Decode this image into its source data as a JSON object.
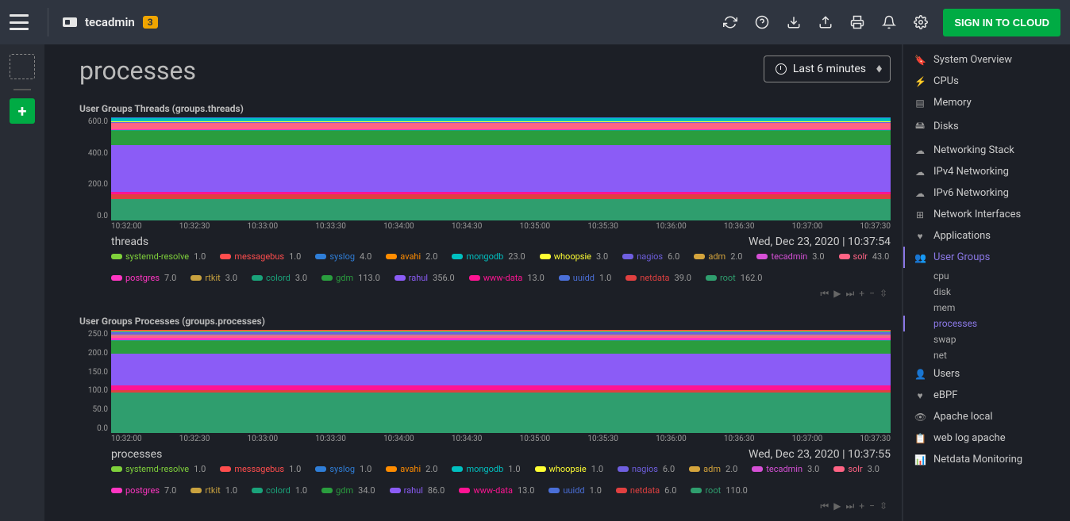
{
  "header": {
    "node_name": "tecadmin",
    "badge": "3",
    "signin": "SIGN IN TO CLOUD"
  },
  "time_picker": "Last 6 minutes",
  "page_title": "processes",
  "nav": [
    {
      "icon": "🔖",
      "label": "System Overview"
    },
    {
      "icon": "⚡",
      "label": "CPUs"
    },
    {
      "icon": "▤",
      "label": "Memory"
    },
    {
      "icon": "🖴",
      "label": "Disks"
    },
    {
      "icon": "☁",
      "label": "Networking Stack"
    },
    {
      "icon": "☁",
      "label": "IPv4 Networking"
    },
    {
      "icon": "☁",
      "label": "IPv6 Networking"
    },
    {
      "icon": "⊞",
      "label": "Network Interfaces"
    },
    {
      "icon": "♥",
      "label": "Applications"
    },
    {
      "icon": "👥",
      "label": "User Groups",
      "active": true,
      "subs": [
        {
          "label": "cpu"
        },
        {
          "label": "disk"
        },
        {
          "label": "mem"
        },
        {
          "label": "processes",
          "active": true
        },
        {
          "label": "swap"
        },
        {
          "label": "net"
        }
      ]
    },
    {
      "icon": "👤",
      "label": "Users"
    },
    {
      "icon": "♥",
      "label": "eBPF"
    },
    {
      "icon": "👁",
      "label": "Apache local"
    },
    {
      "icon": "📋",
      "label": "web log apache"
    },
    {
      "icon": "📊",
      "label": "Netdata Monitoring"
    }
  ],
  "chart_data": [
    {
      "type": "area",
      "title": "User Groups Threads (groups.threads)",
      "unit": "threads",
      "timestamp": "Wed, Dec 23, 2020 | 10:37:54",
      "ylim": [
        0,
        700
      ],
      "yticks": [
        "600.0",
        "400.0",
        "200.0",
        "0.0"
      ],
      "xticks": [
        "10:32:00",
        "10:32:30",
        "10:33:00",
        "10:33:30",
        "10:34:00",
        "10:34:30",
        "10:35:00",
        "10:35:30",
        "10:36:00",
        "10:36:30",
        "10:37:00",
        "10:37:30"
      ],
      "series": [
        {
          "name": "systemd-resolve",
          "value": 1.0,
          "color": "#7fd13b"
        },
        {
          "name": "messagebus",
          "value": 1.0,
          "color": "#ff4d4d"
        },
        {
          "name": "syslog",
          "value": 4.0,
          "color": "#2f7ed8"
        },
        {
          "name": "avahi",
          "value": 2.0,
          "color": "#ff8c00"
        },
        {
          "name": "mongodb",
          "value": 23.0,
          "color": "#00c0c0"
        },
        {
          "name": "whoopsie",
          "value": 3.0,
          "color": "#ffff33"
        },
        {
          "name": "nagios",
          "value": 6.0,
          "color": "#6f5fe0"
        },
        {
          "name": "adm",
          "value": 2.0,
          "color": "#d4a43c"
        },
        {
          "name": "tecadmin",
          "value": 3.0,
          "color": "#d650d6"
        },
        {
          "name": "solr",
          "value": 43.0,
          "color": "#ff6384"
        },
        {
          "name": "postgres",
          "value": 7.0,
          "color": "#ff36c2"
        },
        {
          "name": "rtkit",
          "value": 3.0,
          "color": "#c9a23f"
        },
        {
          "name": "colord",
          "value": 3.0,
          "color": "#1aa37a"
        },
        {
          "name": "gdm",
          "value": 113.0,
          "color": "#2a9d3e"
        },
        {
          "name": "rahul",
          "value": 356.0,
          "color": "#8b5cf6"
        },
        {
          "name": "www-data",
          "value": 13.0,
          "color": "#ff1493"
        },
        {
          "name": "uuidd",
          "value": 1.0,
          "color": "#4a6fd8"
        },
        {
          "name": "netdata",
          "value": 39.0,
          "color": "#e04040"
        },
        {
          "name": "root",
          "value": 162.0,
          "color": "#2f9e6e"
        }
      ]
    },
    {
      "type": "area",
      "title": "User Groups Processes (groups.processes)",
      "unit": "processes",
      "timestamp": "Wed, Dec 23, 2020 | 10:37:55",
      "ylim": [
        0,
        270
      ],
      "yticks": [
        "250.0",
        "200.0",
        "150.0",
        "100.0",
        "50.0",
        "0.0"
      ],
      "xticks": [
        "10:32:00",
        "10:32:30",
        "10:33:00",
        "10:33:30",
        "10:34:00",
        "10:34:30",
        "10:35:00",
        "10:35:30",
        "10:36:00",
        "10:36:30",
        "10:37:00",
        "10:37:30"
      ],
      "series": [
        {
          "name": "systemd-resolve",
          "value": 1.0,
          "color": "#7fd13b"
        },
        {
          "name": "messagebus",
          "value": 1.0,
          "color": "#ff4d4d"
        },
        {
          "name": "syslog",
          "value": 1.0,
          "color": "#2f7ed8"
        },
        {
          "name": "avahi",
          "value": 2.0,
          "color": "#ff8c00"
        },
        {
          "name": "mongodb",
          "value": 1.0,
          "color": "#00c0c0"
        },
        {
          "name": "whoopsie",
          "value": 1.0,
          "color": "#ffff33"
        },
        {
          "name": "nagios",
          "value": 6.0,
          "color": "#6f5fe0"
        },
        {
          "name": "adm",
          "value": 2.0,
          "color": "#d4a43c"
        },
        {
          "name": "tecadmin",
          "value": 3.0,
          "color": "#d650d6"
        },
        {
          "name": "solr",
          "value": 3.0,
          "color": "#ff6384"
        },
        {
          "name": "postgres",
          "value": 7.0,
          "color": "#ff36c2"
        },
        {
          "name": "rtkit",
          "value": 1.0,
          "color": "#c9a23f"
        },
        {
          "name": "colord",
          "value": 1.0,
          "color": "#1aa37a"
        },
        {
          "name": "gdm",
          "value": 34.0,
          "color": "#2a9d3e"
        },
        {
          "name": "rahul",
          "value": 86.0,
          "color": "#8b5cf6"
        },
        {
          "name": "www-data",
          "value": 13.0,
          "color": "#ff1493"
        },
        {
          "name": "uuidd",
          "value": 1.0,
          "color": "#4a6fd8"
        },
        {
          "name": "netdata",
          "value": 6.0,
          "color": "#e04040"
        },
        {
          "name": "root",
          "value": 110.0,
          "color": "#2f9e6e"
        }
      ]
    }
  ]
}
